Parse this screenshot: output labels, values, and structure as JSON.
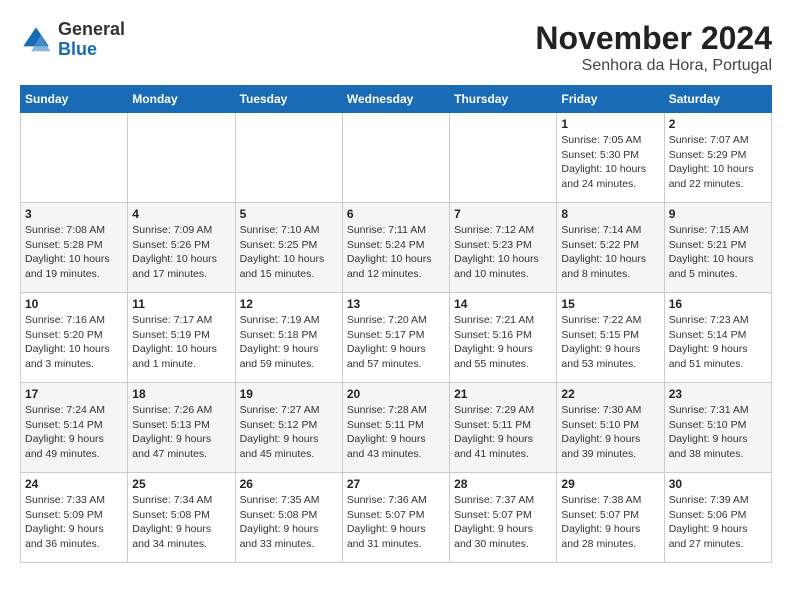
{
  "logo": {
    "general": "General",
    "blue": "Blue"
  },
  "title": "November 2024",
  "subtitle": "Senhora da Hora, Portugal",
  "days_of_week": [
    "Sunday",
    "Monday",
    "Tuesday",
    "Wednesday",
    "Thursday",
    "Friday",
    "Saturday"
  ],
  "weeks": [
    [
      {
        "day": "",
        "info": ""
      },
      {
        "day": "",
        "info": ""
      },
      {
        "day": "",
        "info": ""
      },
      {
        "day": "",
        "info": ""
      },
      {
        "day": "",
        "info": ""
      },
      {
        "day": "1",
        "info": "Sunrise: 7:05 AM\nSunset: 5:30 PM\nDaylight: 10 hours and 24 minutes."
      },
      {
        "day": "2",
        "info": "Sunrise: 7:07 AM\nSunset: 5:29 PM\nDaylight: 10 hours and 22 minutes."
      }
    ],
    [
      {
        "day": "3",
        "info": "Sunrise: 7:08 AM\nSunset: 5:28 PM\nDaylight: 10 hours and 19 minutes."
      },
      {
        "day": "4",
        "info": "Sunrise: 7:09 AM\nSunset: 5:26 PM\nDaylight: 10 hours and 17 minutes."
      },
      {
        "day": "5",
        "info": "Sunrise: 7:10 AM\nSunset: 5:25 PM\nDaylight: 10 hours and 15 minutes."
      },
      {
        "day": "6",
        "info": "Sunrise: 7:11 AM\nSunset: 5:24 PM\nDaylight: 10 hours and 12 minutes."
      },
      {
        "day": "7",
        "info": "Sunrise: 7:12 AM\nSunset: 5:23 PM\nDaylight: 10 hours and 10 minutes."
      },
      {
        "day": "8",
        "info": "Sunrise: 7:14 AM\nSunset: 5:22 PM\nDaylight: 10 hours and 8 minutes."
      },
      {
        "day": "9",
        "info": "Sunrise: 7:15 AM\nSunset: 5:21 PM\nDaylight: 10 hours and 5 minutes."
      }
    ],
    [
      {
        "day": "10",
        "info": "Sunrise: 7:16 AM\nSunset: 5:20 PM\nDaylight: 10 hours and 3 minutes."
      },
      {
        "day": "11",
        "info": "Sunrise: 7:17 AM\nSunset: 5:19 PM\nDaylight: 10 hours and 1 minute."
      },
      {
        "day": "12",
        "info": "Sunrise: 7:19 AM\nSunset: 5:18 PM\nDaylight: 9 hours and 59 minutes."
      },
      {
        "day": "13",
        "info": "Sunrise: 7:20 AM\nSunset: 5:17 PM\nDaylight: 9 hours and 57 minutes."
      },
      {
        "day": "14",
        "info": "Sunrise: 7:21 AM\nSunset: 5:16 PM\nDaylight: 9 hours and 55 minutes."
      },
      {
        "day": "15",
        "info": "Sunrise: 7:22 AM\nSunset: 5:15 PM\nDaylight: 9 hours and 53 minutes."
      },
      {
        "day": "16",
        "info": "Sunrise: 7:23 AM\nSunset: 5:14 PM\nDaylight: 9 hours and 51 minutes."
      }
    ],
    [
      {
        "day": "17",
        "info": "Sunrise: 7:24 AM\nSunset: 5:14 PM\nDaylight: 9 hours and 49 minutes."
      },
      {
        "day": "18",
        "info": "Sunrise: 7:26 AM\nSunset: 5:13 PM\nDaylight: 9 hours and 47 minutes."
      },
      {
        "day": "19",
        "info": "Sunrise: 7:27 AM\nSunset: 5:12 PM\nDaylight: 9 hours and 45 minutes."
      },
      {
        "day": "20",
        "info": "Sunrise: 7:28 AM\nSunset: 5:11 PM\nDaylight: 9 hours and 43 minutes."
      },
      {
        "day": "21",
        "info": "Sunrise: 7:29 AM\nSunset: 5:11 PM\nDaylight: 9 hours and 41 minutes."
      },
      {
        "day": "22",
        "info": "Sunrise: 7:30 AM\nSunset: 5:10 PM\nDaylight: 9 hours and 39 minutes."
      },
      {
        "day": "23",
        "info": "Sunrise: 7:31 AM\nSunset: 5:10 PM\nDaylight: 9 hours and 38 minutes."
      }
    ],
    [
      {
        "day": "24",
        "info": "Sunrise: 7:33 AM\nSunset: 5:09 PM\nDaylight: 9 hours and 36 minutes."
      },
      {
        "day": "25",
        "info": "Sunrise: 7:34 AM\nSunset: 5:08 PM\nDaylight: 9 hours and 34 minutes."
      },
      {
        "day": "26",
        "info": "Sunrise: 7:35 AM\nSunset: 5:08 PM\nDaylight: 9 hours and 33 minutes."
      },
      {
        "day": "27",
        "info": "Sunrise: 7:36 AM\nSunset: 5:07 PM\nDaylight: 9 hours and 31 minutes."
      },
      {
        "day": "28",
        "info": "Sunrise: 7:37 AM\nSunset: 5:07 PM\nDaylight: 9 hours and 30 minutes."
      },
      {
        "day": "29",
        "info": "Sunrise: 7:38 AM\nSunset: 5:07 PM\nDaylight: 9 hours and 28 minutes."
      },
      {
        "day": "30",
        "info": "Sunrise: 7:39 AM\nSunset: 5:06 PM\nDaylight: 9 hours and 27 minutes."
      }
    ]
  ]
}
